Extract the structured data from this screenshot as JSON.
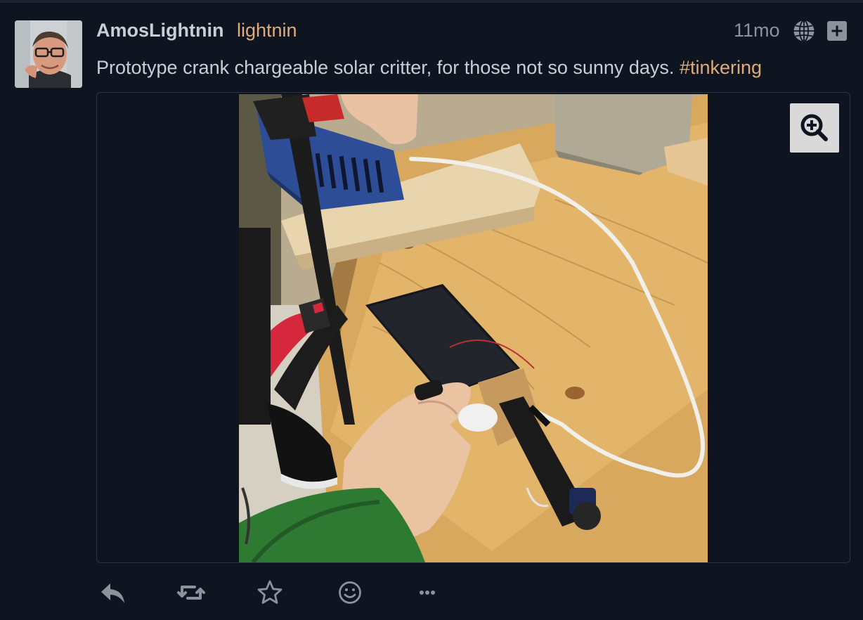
{
  "status": {
    "display_name": "AmosLightnin",
    "acct": "lightnin",
    "timestamp": "11mo",
    "content_text": "Prototype crank chargeable solar critter, for those not so sunny days. ",
    "hashtag": "#tinkering"
  },
  "icons": {
    "visibility": "globe-icon",
    "expand": "plus-icon",
    "zoom": "zoom-in-icon",
    "reply": "reply-icon",
    "boost": "boost-icon",
    "favourite": "star-icon",
    "react": "smiley-icon",
    "more": "ellipsis-icon"
  },
  "colors": {
    "background": "#0f1520",
    "text": "#c8cdd6",
    "accent": "#e0ab76",
    "muted": "#8a93a2",
    "action_icon": "#8b929c"
  }
}
